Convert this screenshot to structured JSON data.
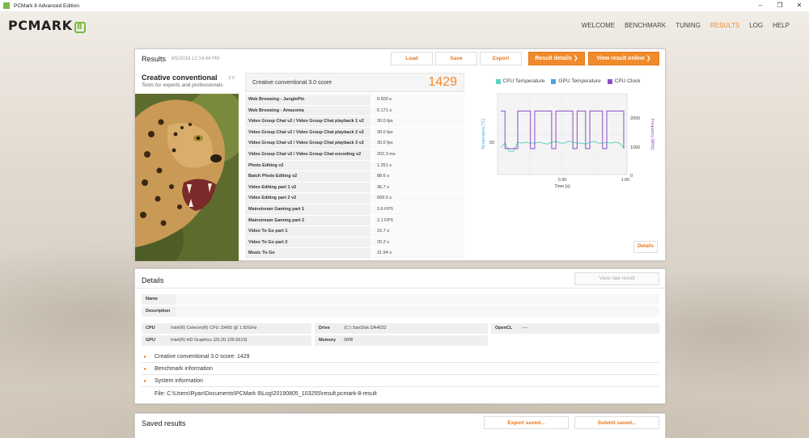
{
  "window": {
    "title": "PCMark 8 Advanced Edition",
    "minimize": "–",
    "maximize": "❐",
    "close": "✕"
  },
  "brand": {
    "logo_text": "PCMARK",
    "logo_num": "8"
  },
  "nav": [
    "WELCOME",
    "BENCHMARK",
    "TUNING",
    "RESULTS",
    "LOG",
    "HELP"
  ],
  "nav_active": "RESULTS",
  "results": {
    "title": "Results",
    "timestamp": "8/5/2019 12:14:44 PM",
    "buttons": {
      "load": "Load",
      "save": "Save",
      "export": "Export",
      "result_details": "Result details ❯",
      "view_online": "View result online ❯"
    },
    "test_name": "Creative conventional",
    "test_version": "3.0",
    "test_desc": "Tests for experts and professionals",
    "score_label": "Creative conventional 3.0 score",
    "score": "1429",
    "rows": [
      {
        "name": "Web Browsing - JunglePin",
        "value": "0.500 s"
      },
      {
        "name": "Web Browsing - Amazonia",
        "value": "0.171 s"
      },
      {
        "name": "Video Group Chat v2 / Video Group Chat playback 1 v2",
        "value": "30.0 fps"
      },
      {
        "name": "Video Group Chat v2 / Video Group Chat playback 2 v2",
        "value": "30.0 fps"
      },
      {
        "name": "Video Group Chat v2 / Video Group Chat playback 3 v2",
        "value": "30.0 fps"
      },
      {
        "name": "Video Group Chat v2 / Video Group Chat encoding v2",
        "value": "202.3 ms"
      },
      {
        "name": "Photo Editing v2",
        "value": "1.251 s"
      },
      {
        "name": "Batch Photo Editing v2",
        "value": "88.6 s"
      },
      {
        "name": "Video Editing part 1 v2",
        "value": "36.7 s"
      },
      {
        "name": "Video Editing part 2 v2",
        "value": "699.5 s"
      },
      {
        "name": "Mainstream Gaming part 1",
        "value": "3.6 FPS"
      },
      {
        "name": "Mainstream Gaming part 2",
        "value": "2.1 FPS"
      },
      {
        "name": "Video To Go part 1",
        "value": "15.7 s"
      },
      {
        "name": "Video To Go part 2",
        "value": "20.2 s"
      },
      {
        "name": "Music To Go",
        "value": "31.94 s"
      }
    ],
    "details_button": "Details"
  },
  "chart_data": {
    "type": "line",
    "series": [
      {
        "name": "CPU Temperature",
        "color": "#5bd6c0",
        "axis": "left",
        "values": [
          50,
          55,
          46,
          46,
          56,
          55,
          56,
          55,
          55,
          56,
          55,
          54,
          56,
          57,
          55,
          55,
          57,
          56,
          55,
          55,
          54,
          56,
          57,
          55,
          55,
          56,
          55,
          56,
          55,
          50
        ]
      },
      {
        "name": "GPU Temperature",
        "color": "#4aa3e0",
        "axis": "left",
        "values": []
      },
      {
        "name": "CPU Clock",
        "color": "#8b4ec6",
        "axis": "right",
        "values": [
          2200,
          900,
          900,
          900,
          2200,
          2200,
          2200,
          900,
          2200,
          2200,
          2200,
          2200,
          900,
          2200,
          2200,
          2200,
          2200,
          900,
          2200,
          2200,
          900,
          2200,
          2200,
          2200,
          900,
          2200,
          2200,
          2200,
          2200,
          900
        ]
      },
      {
        "name": "_cpu_clock_low_axis_unused",
        "color": "",
        "axis": "right",
        "values": []
      }
    ],
    "x_ticks": [
      "0:30",
      "1:00"
    ],
    "xlabel": "Time [s]",
    "ylabel_left": "Temperature [°C]",
    "ylabel_right": "Frequency [MHz]",
    "y_left_ticks": [
      "50"
    ],
    "y_right_ticks": [
      "2000",
      "1000",
      "0"
    ],
    "grid": true,
    "legend_position": "top"
  },
  "details": {
    "title": "Details",
    "raw_button": "View raw result",
    "name_label": "Name",
    "desc_label": "Description",
    "cpu_label": "CPU",
    "cpu_value": "Intel(R) Celeron(R) CPU J3455 @ 1.50GHz",
    "gpu_label": "GPU",
    "gpu_value": "Intel(R) HD Graphics (25.20.100.6519)",
    "drive_label": "Drive",
    "drive_value": "(C:) SanDisk DA4032",
    "memory_label": "Memory",
    "memory_value": "0MB",
    "opencl_label": "OpenCL",
    "opencl_value": "----",
    "expanders": [
      "Creative conventional 3.0 score: 1429",
      "Benchmark information",
      "System information"
    ],
    "file_line": "File: C:\\Users\\Ryan\\Documents\\PCMark 8\\Log\\20190805_103255\\result.pcmark-8-result"
  },
  "saved": {
    "title": "Saved results",
    "export_button": "Export saved...",
    "submit_button": "Submit saved..."
  }
}
